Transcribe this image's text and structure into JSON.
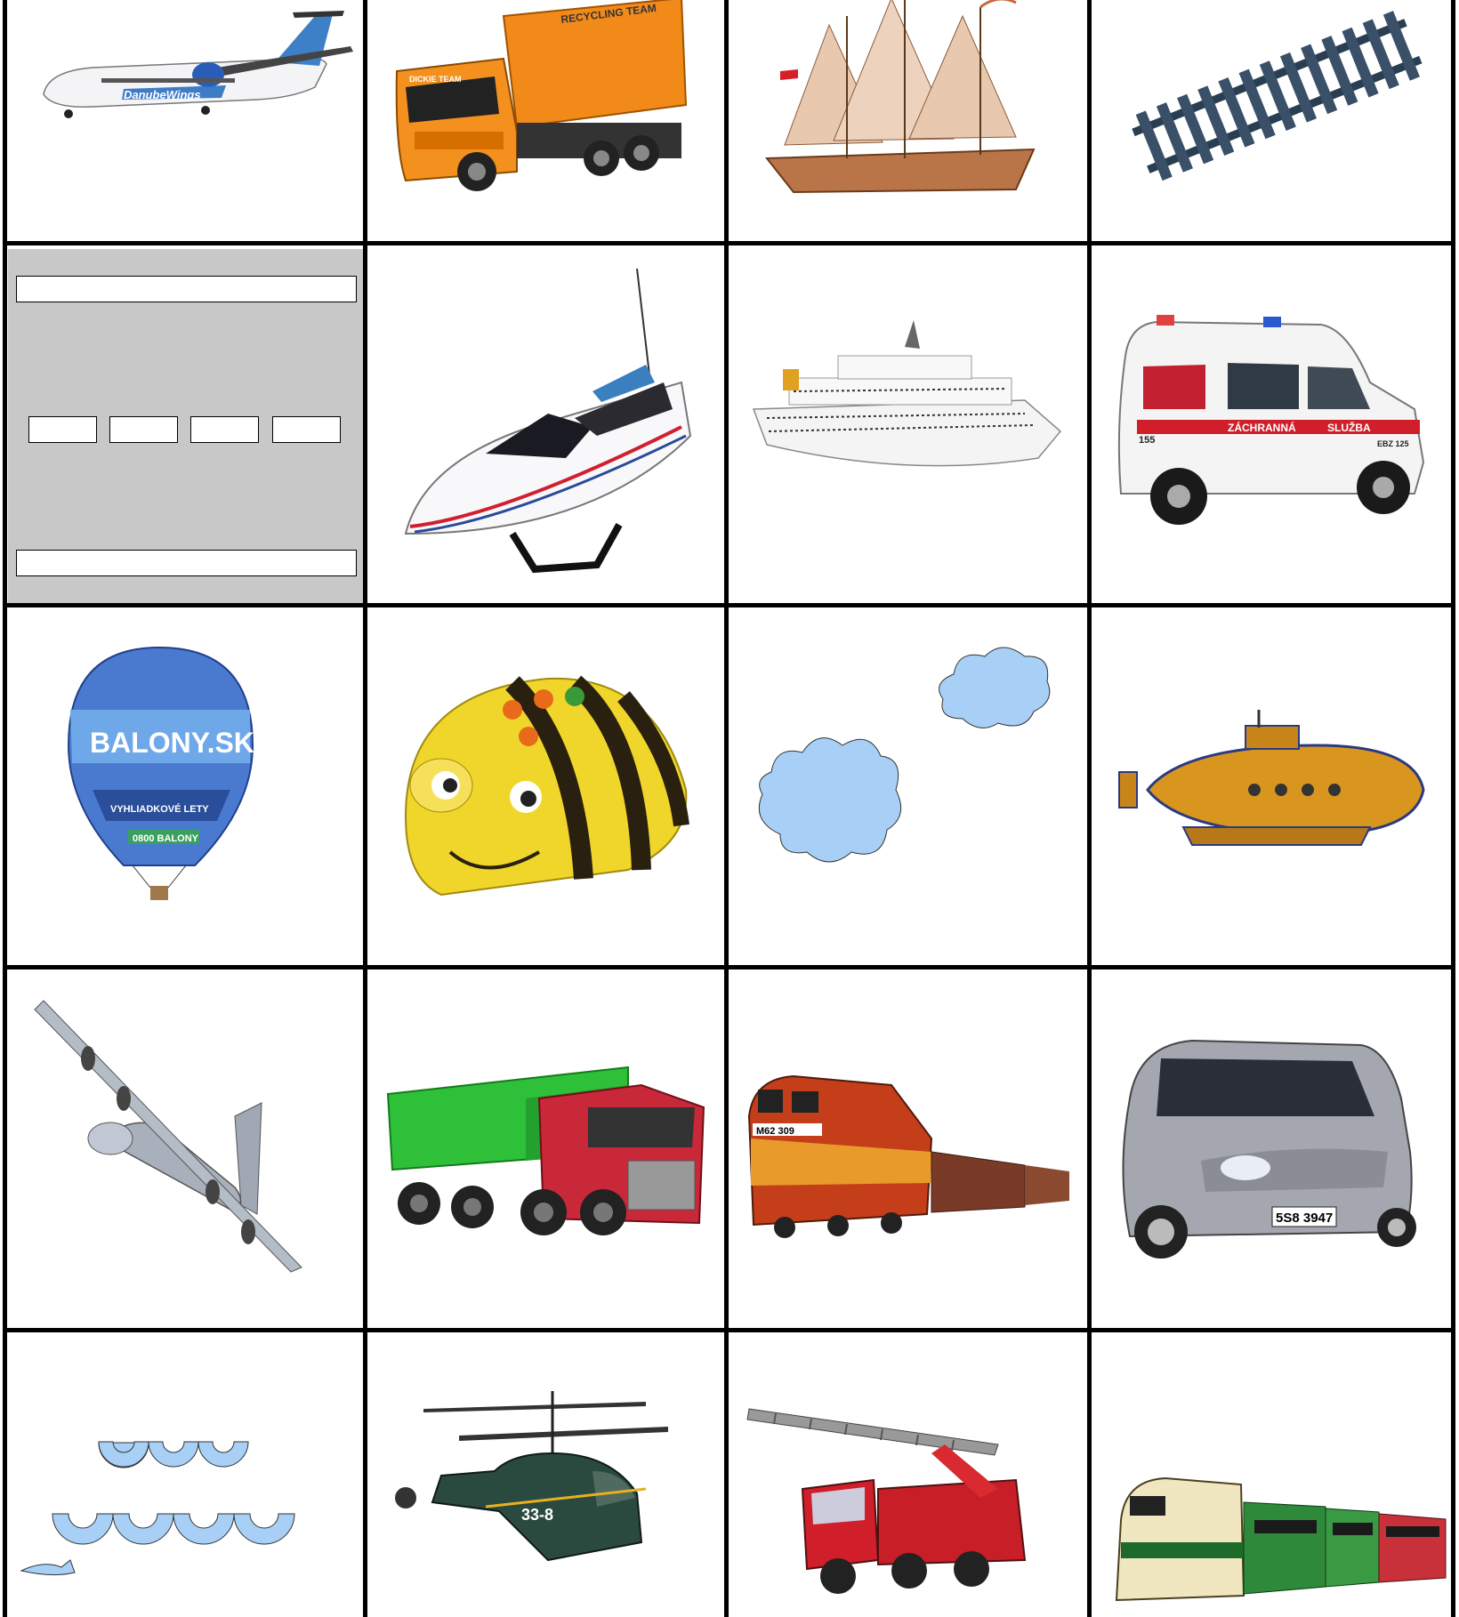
{
  "colors": {
    "border": "#000000",
    "cell_bg": "#ffffff",
    "panel_bg": "#c8c8c8",
    "cloud": "#a8cff5",
    "water": "#a8cff5"
  },
  "board": {
    "rows": 5,
    "cols": 4
  },
  "tiles": [
    {
      "id": "r1c1",
      "icon": "turboprop-airplane-icon",
      "text": "DanubeWings"
    },
    {
      "id": "r1c2",
      "icon": "garbage-truck-icon",
      "text_top": "RECYCLING TEAM",
      "text_cab": "DICKIE TEAM"
    },
    {
      "id": "r1c3",
      "icon": "sailing-ship-icon"
    },
    {
      "id": "r1c4",
      "icon": "rail-track-icon"
    },
    {
      "id": "r2c1",
      "icon": "answer-panel"
    },
    {
      "id": "r2c2",
      "icon": "speedboat-icon"
    },
    {
      "id": "r2c3",
      "icon": "cruise-ship-icon"
    },
    {
      "id": "r2c4",
      "icon": "ambulance-icon",
      "text_1": "155",
      "text_2": "ZÁCHRANNÁ",
      "text_3": "SLUŽBA",
      "text_4": "EBZ 125"
    },
    {
      "id": "r3c1",
      "icon": "hot-air-balloon-icon",
      "text_1": "BALONY.SK",
      "text_2": "VYHLIADKOVÉ LETY",
      "text_3": "0800 BALONY"
    },
    {
      "id": "r3c2",
      "icon": "bee-bot-icon"
    },
    {
      "id": "r3c3",
      "icon": "clouds-icon"
    },
    {
      "id": "r3c4",
      "icon": "submarine-icon"
    },
    {
      "id": "r4c1",
      "icon": "cargo-airplane-icon"
    },
    {
      "id": "r4c2",
      "icon": "dump-truck-icon"
    },
    {
      "id": "r4c3",
      "icon": "diesel-locomotive-icon",
      "text": "M62 309"
    },
    {
      "id": "r4c4",
      "icon": "car-icon",
      "text": "5S8 3947"
    },
    {
      "id": "r5c1",
      "icon": "waves-icon"
    },
    {
      "id": "r5c2",
      "icon": "helicopter-icon",
      "text": "33-8"
    },
    {
      "id": "r5c3",
      "icon": "fire-truck-icon"
    },
    {
      "id": "r5c4",
      "icon": "passenger-train-icon"
    }
  ]
}
